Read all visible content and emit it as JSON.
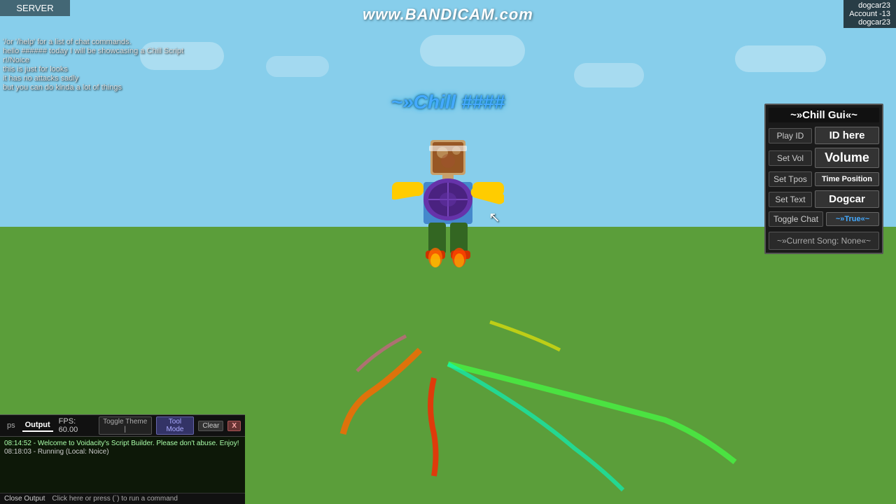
{
  "watermark": {
    "text": "www.BANDICAM.com"
  },
  "user_info": {
    "username": "dogcar23",
    "account_label": "Account -13",
    "display": "dogcar23"
  },
  "server": {
    "label": "SERVER"
  },
  "chat": {
    "messages": [
      {
        "text": "'/or '/help' for a list of chat commands."
      },
      {
        "text": "hello ###### today I will be showcasing a Chill Script"
      },
      {
        "text": "r!/Noice"
      },
      {
        "text": "this is just for looks"
      },
      {
        "text": "it has no attacks sadly"
      },
      {
        "text": "but you can do kinda a lot of things"
      }
    ]
  },
  "float_title": {
    "text": "~»Chill  ####"
  },
  "chill_gui": {
    "title": "~»Chill Gui«~",
    "rows": [
      {
        "label": "Play ID",
        "value": "ID here",
        "value_size": "medium"
      },
      {
        "label": "Set Vol",
        "value": "Volume",
        "value_size": "large"
      },
      {
        "label": "Set Tpos",
        "value": "Time Position",
        "value_size": "small"
      },
      {
        "label": "Set Text",
        "value": "Dogcar",
        "value_size": "medium"
      },
      {
        "label": "Toggle Chat",
        "value": "~»True«~",
        "value_size": "small"
      }
    ],
    "current_song": "~»Current Song: None«~"
  },
  "output_panel": {
    "tab_label": "Output",
    "fps_label": "FPS: 60.00",
    "toggle_theme_btn": "Toggle Theme |",
    "tool_mode_btn": "Tool Mode",
    "clear_btn": "Clear",
    "close_x": "X",
    "lines": [
      {
        "text": "08:14:52 - Welcome to Voidacity's Script Builder. Please don't abuse. Enjoy!"
      },
      {
        "text": "08:18:03 - Running (Local: Noice)"
      }
    ],
    "footer_close": "Close Output",
    "footer_run": "Click here or press (`) to run a command"
  }
}
